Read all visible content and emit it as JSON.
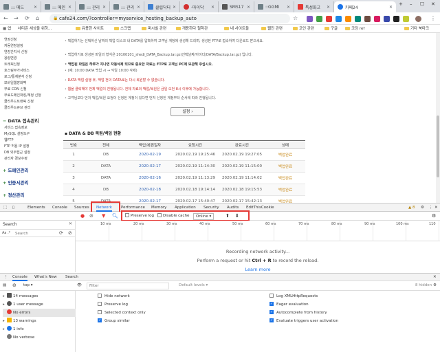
{
  "browser": {
    "tabs": [
      {
        "label": "::: 메드",
        "color": "#6e7f86"
      },
      {
        "label": "::: 메인 -",
        "color": "#6e7f86"
      },
      {
        "label": "::: 관리 -",
        "color": "#6e7f86"
      },
      {
        "label": "::: 관리 -",
        "color": "#6e7f86"
      },
      {
        "label": "클럽닥터",
        "color": "#3d7fd1"
      },
      {
        "label": "·마이닥",
        "color": "#d32f2f"
      },
      {
        "label": "SMS17",
        "color": "#555555"
      },
      {
        "label": "::GGMI",
        "color": "#6e7f86"
      },
      {
        "label": "특성화고",
        "color": "#e53935"
      },
      {
        "label": "카페24",
        "color": "#1a73e8"
      }
    ],
    "active_tab_index": 9,
    "url": "cafe24.com/?controller=myservice_hosting_backup_auto",
    "bookmarks": [
      "앱",
      "네티즌 세상을 위하...",
      "유용한 사이트",
      "스크랩",
      "퍼시빌 관련",
      "개용하다 철학관",
      "내 사이트들",
      "웹진 관련",
      "코인 관련",
      "구글",
      "코딩 ref",
      "기타 북마크"
    ]
  },
  "sidebar": {
    "items": [
      "연장신청",
      "자동연장설정",
      "연장간지서 신청",
      "용량변경",
      "트래픽신청",
      "호스팅부가서비스",
      "로그/통계분석 신청",
      "모바일웹방화벽",
      "무료 CDN 신청",
      "무료도메인파킹/계정 신청",
      "클라우드트래픽 신청",
      "클라우드큐브 관리"
    ],
    "section1": "DATA 접속관리",
    "section1_items": [
      "서비스 접속정보",
      "MySQL 설정도구",
      "웹FTP",
      "FTP 허용 IP 설정",
      "DB 외부접근 설정",
      "관리자 경보수정"
    ],
    "section2": "도메인관리",
    "section3": "인증서관리",
    "section4": "정산관리"
  },
  "main": {
    "notices": [
      {
        "text": "백업하기는 선택하신 날짜의 백업 디스크 내 DATA를 압축하여 고객님 계정에 생성해 드리며, 생성된 FTP로 접속하여 다운로드 받으세요.",
        "style": ""
      },
      {
        "text": "백업하기로 생성된 파일의 형식은 20100101_shedi_DATA_Backup.tar.gz(선택날짜/아이디/DATA/Backup.tar.gz) 입니다.",
        "style": ""
      },
      {
        "text": "백업된 파일은 하루가 지나면 자동삭제 되므로 중요한 자료는 FTP로 고객님 PC에 보관해 주십시오.",
        "style": "bold"
      },
      {
        "text": "(예: 10:00 DATA 백업 시 → 익일 10:00 삭제)",
        "style": ""
      },
      {
        "text": "DATA 백업 실행 후, 백업 전의 DATA로는 다시 복원할 수 없습니다.",
        "style": "red"
      },
      {
        "text": "웹을 클릭해야 전체 백업이 진행됩니다. 전체 자료의 백업/복원은 금일 오전 8시 이후에 가능합니다.",
        "style": "red"
      },
      {
        "text": "고객님보다 먼저 백업/복원 요청이 신청된 계정이 있다면 먼저 신청된 계정부터 순서에 따라 진행됩니다.",
        "style": ""
      }
    ],
    "settings_button": "설정",
    "history_title": "DATA & DB 복원/백업 현황",
    "table": {
      "headers": [
        "번호",
        "전체",
        "백업/복원일자",
        "요청시간",
        "완료시간",
        "상태"
      ],
      "rows": [
        [
          "1",
          "DB",
          "2020-02-19",
          "2020.02.19 19:25:46",
          "2020.02.19 19:27:05",
          "백업완료"
        ],
        [
          "2",
          "DATA",
          "2020-02-17",
          "2020.02.19 11:14:30",
          "2020.02.19 11:15:00",
          "백업완료"
        ],
        [
          "3",
          "DATA",
          "2020-02-16",
          "2020.02.19 11:13:29",
          "2020.02.19 11:14:02",
          "백업완료"
        ],
        [
          "4",
          "DB",
          "2020-02-18",
          "2020.02.18 19:14:14",
          "2020.02.18 19:15:53",
          "백업완료"
        ],
        [
          "5",
          "DATA",
          "2020-02-17",
          "2020.02.17 15:40:47",
          "2020.02.17 15:42:13",
          "백업완료"
        ]
      ]
    }
  },
  "devtools": {
    "tabs": [
      "Elements",
      "Console",
      "Sources",
      "Network",
      "Performance",
      "Memory",
      "Application",
      "Security",
      "Audits",
      "EditThisCookie"
    ],
    "active_tab": "Network",
    "warning_count": "8",
    "search_title": "Search",
    "search_case": "Aa",
    "search_placeholder": "Search",
    "toolbar": {
      "preserve_log": "Preserve log",
      "disable_cache": "Disable cache",
      "online": "Online",
      "online_arrow": "▾",
      "upload_icon": "⬆",
      "download_icon": "⬇"
    },
    "timeline_ticks": [
      "10 ms",
      "20 ms",
      "30 ms",
      "40 ms",
      "50 ms",
      "60 ms",
      "70 ms",
      "80 ms",
      "90 ms",
      "100 ms",
      "110"
    ],
    "empty_line1": "Recording network activity...",
    "empty_line2_a": "Perform a request or hit ",
    "empty_line2_b": "Ctrl + R",
    "empty_line2_c": " to record the reload.",
    "learn_more": "Learn more"
  },
  "console": {
    "tabs": [
      "Console",
      "What's New",
      "Search"
    ],
    "context": "top",
    "filter_placeholder": "Filter",
    "levels": "Default levels ▾",
    "hidden": "8 hidden",
    "sidebar": [
      {
        "label": "14 messages",
        "color": "#555555"
      },
      {
        "label": "1 user message",
        "color": "#555555"
      },
      {
        "label": "No errors",
        "color": "#e53935"
      },
      {
        "label": "13 warnings",
        "color": "#f4b400"
      },
      {
        "label": "1 info",
        "color": "#1a73e8"
      },
      {
        "label": "No verbose",
        "color": "#777777"
      }
    ],
    "options_left": [
      {
        "label": "Hide network",
        "checked": false
      },
      {
        "label": "Preserve log",
        "checked": false
      },
      {
        "label": "Selected context only",
        "checked": false
      },
      {
        "label": "Group similar",
        "checked": true
      }
    ],
    "options_right": [
      {
        "label": "Log XMLHttpRequests",
        "checked": false
      },
      {
        "label": "Eager evaluation",
        "checked": true
      },
      {
        "label": "Autocomplete from history",
        "checked": true
      },
      {
        "label": "Evaluate triggers user activation",
        "checked": true
      }
    ]
  }
}
